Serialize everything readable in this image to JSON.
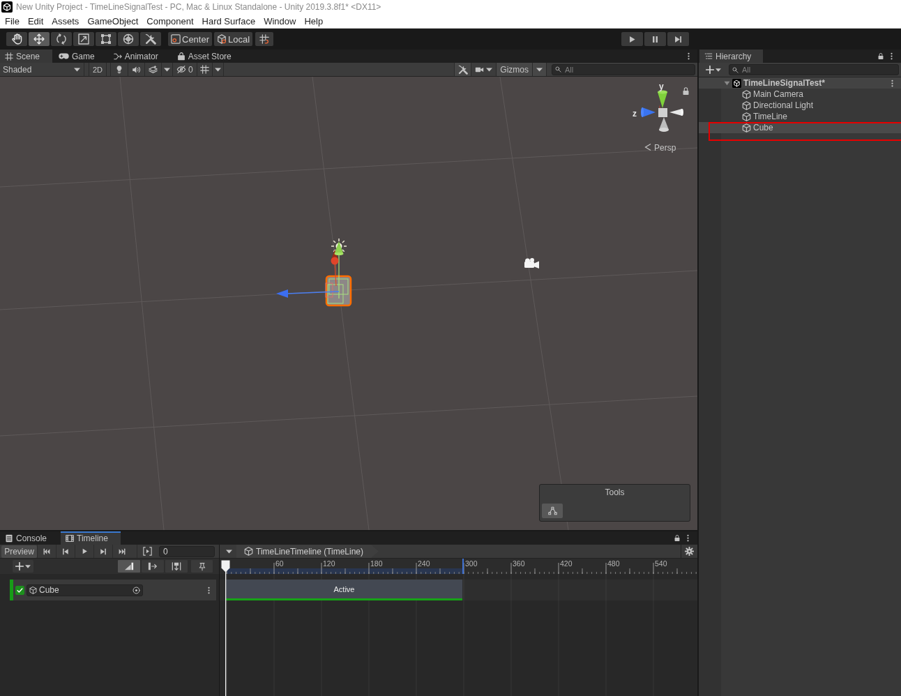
{
  "window": {
    "title": "New Unity Project - TimeLineSignalTest - PC, Mac & Linux Standalone - Unity 2019.3.8f1* <DX11>"
  },
  "menu": [
    "File",
    "Edit",
    "Assets",
    "GameObject",
    "Component",
    "Hard Surface",
    "Window",
    "Help"
  ],
  "toolbar": {
    "tools": [
      {
        "kind": "hand",
        "selected": false
      },
      {
        "kind": "move",
        "selected": true
      },
      {
        "kind": "rotate",
        "selected": false
      },
      {
        "kind": "scale",
        "selected": false
      },
      {
        "kind": "rect",
        "selected": false
      },
      {
        "kind": "transform",
        "selected": false
      },
      {
        "kind": "custom",
        "selected": false
      }
    ],
    "pivot": [
      {
        "kind": "pivot",
        "label": "Center"
      },
      {
        "kind": "space",
        "label": "Local"
      }
    ]
  },
  "scene_view": {
    "tabs": [
      {
        "kind": "scene",
        "label": "Scene",
        "selected": true
      },
      {
        "kind": "game",
        "label": "Game",
        "selected": false
      },
      {
        "kind": "animator",
        "label": "Animator",
        "selected": false
      },
      {
        "kind": "store",
        "label": "Asset Store",
        "selected": false
      }
    ],
    "draw_mode": "Shaded",
    "mode_2d": "2D",
    "hidden_count": "0",
    "gizmos": "Gizmos",
    "search": {
      "placeholder": "All"
    },
    "orientation": {
      "y_label": "y",
      "z_label": "z",
      "projection": "Persp"
    },
    "overlay": {
      "title": "Tools"
    }
  },
  "hierarchy": {
    "tab": "Hierarchy",
    "search": {
      "placeholder": "All"
    },
    "scene": {
      "name": "TimeLineSignalTest*",
      "expanded": true,
      "children": [
        {
          "name": "Main Camera",
          "highlighted": false
        },
        {
          "name": "Directional Light",
          "highlighted": false
        },
        {
          "name": "TimeLine",
          "highlighted": false
        },
        {
          "name": "Cube",
          "highlighted": true
        }
      ]
    }
  },
  "annotation": {
    "kind": "outline"
  },
  "bottom_panel": {
    "tabs": [
      {
        "kind": "console",
        "label": "Console",
        "selected": false
      },
      {
        "kind": "timeline",
        "label": "Timeline",
        "selected": true
      }
    ]
  },
  "timeline": {
    "preview": "Preview",
    "frame": "0",
    "asset": "TimeLineTimeline (TimeLine)",
    "edit_modes": [
      {
        "kind": "mix",
        "selected": true
      },
      {
        "kind": "ripple",
        "selected": false
      },
      {
        "kind": "replace",
        "selected": false
      }
    ],
    "ruler": [
      "60",
      "120",
      "180",
      "240",
      "300",
      "360",
      "420",
      "480",
      "540"
    ],
    "tracks": [
      {
        "name": "Cube",
        "enabled": true,
        "clips": [
          {
            "label": "Active"
          }
        ]
      }
    ]
  }
}
